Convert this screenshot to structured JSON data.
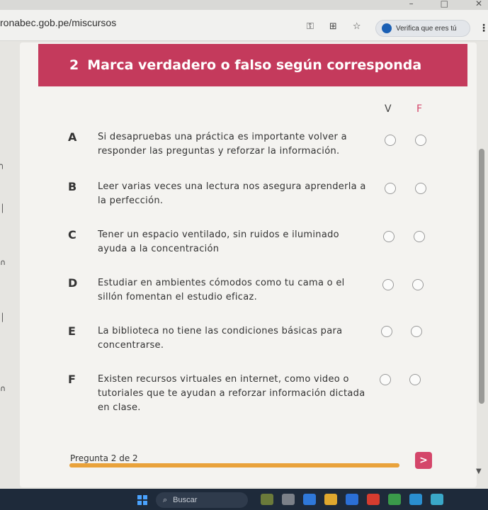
{
  "browser": {
    "url": "ronabec.gob.pe/miscursos",
    "verify_label": "Verifica que eres tú",
    "icons": [
      "key-icon",
      "translate-icon",
      "star-icon"
    ]
  },
  "quiz": {
    "number": "2",
    "title": "Marca verdadero o falso según corresponda",
    "col_true": "V",
    "col_false": "F",
    "questions": [
      {
        "letter": "A",
        "text": "Si desapruebas una práctica es importante volver a responder las preguntas y reforzar la información."
      },
      {
        "letter": "B",
        "text": "Leer varias veces una lectura nos asegura aprenderla a la perfección."
      },
      {
        "letter": "C",
        "text": "Tener un espacio ventilado, sin ruidos e iluminado ayuda a la concentración"
      },
      {
        "letter": "D",
        "text": "Estudiar en ambientes cómodos como tu cama o el sillón fomentan el estudio eficaz."
      },
      {
        "letter": "E",
        "text": "La biblioteca no tiene las condiciones básicas para concentrarse."
      },
      {
        "letter": "F",
        "text": "Existen recursos virtuales en internet, como video o tutoriales que te ayudan a reforzar información dictada en clase."
      }
    ],
    "footer": "Pregunta 2 de 2",
    "progress": 1.0,
    "next_symbol": ">"
  },
  "taskbar": {
    "search_placeholder": "Buscar"
  },
  "colors": {
    "accent": "#c43a5c",
    "progress": "#e9a23b"
  }
}
